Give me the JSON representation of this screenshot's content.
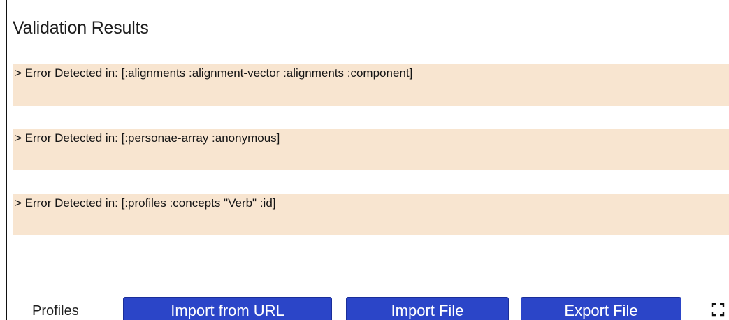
{
  "validation": {
    "title": "Validation Results",
    "errors": [
      "> Error Detected in: [:alignments :alignment-vector :alignments :component]",
      "> Error Detected in: [:personae-array :anonymous]",
      "> Error Detected in: [:profiles :concepts \"Verb\" :id]"
    ]
  },
  "footer": {
    "label": "Profiles",
    "buttons": {
      "import_url": "Import from URL",
      "import_file": "Import File",
      "export_file": "Export File"
    },
    "fullscreen_icon": "fullscreen-icon"
  },
  "colors": {
    "error_background": "#f8e5d0",
    "button_background": "#2b45c8",
    "button_text": "#ffffff"
  }
}
